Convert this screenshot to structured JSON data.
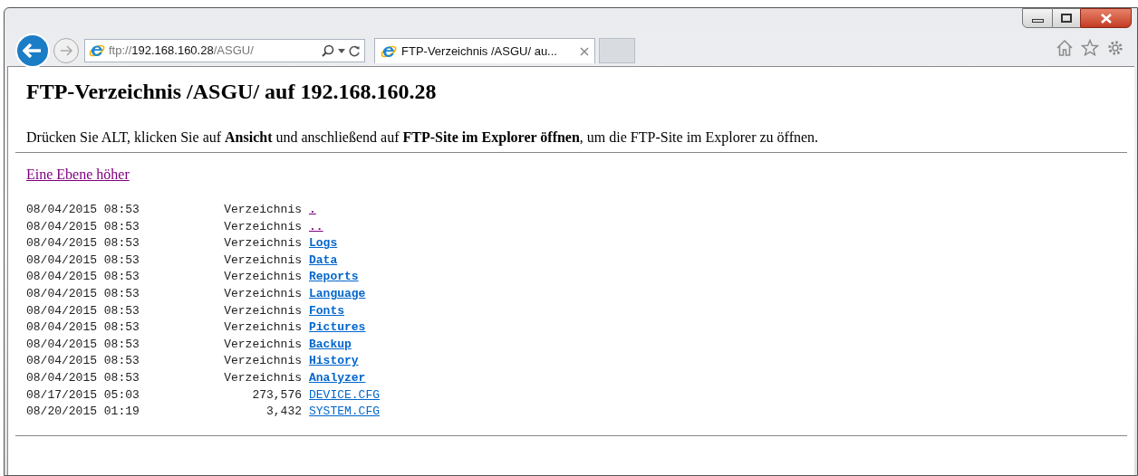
{
  "address": {
    "scheme": "ftp://",
    "host": "192.168.160.28",
    "path": "/ASGU/"
  },
  "tab": {
    "title": "FTP-Verzeichnis /ASGU/ au...",
    "selected": true
  },
  "page": {
    "heading": "FTP-Verzeichnis /ASGU/ auf 192.168.160.28",
    "instruction": "Drücken Sie ALT, klicken Sie auf **Ansicht** und anschließend auf **FTP-Site im Explorer öffnen**, um die FTP-Site im Explorer zu öffnen.",
    "up_link": {
      "label": "Eine Ebene höher",
      "visited": true
    },
    "entries": [
      {
        "date": "08/04/2015 08:53",
        "info": "Verzeichnis",
        "name": ".",
        "kind": "dir",
        "visited": true
      },
      {
        "date": "08/04/2015 08:53",
        "info": "Verzeichnis",
        "name": "..",
        "kind": "dir",
        "visited": true
      },
      {
        "date": "08/04/2015 08:53",
        "info": "Verzeichnis",
        "name": "Logs",
        "kind": "dir",
        "visited": false
      },
      {
        "date": "08/04/2015 08:53",
        "info": "Verzeichnis",
        "name": "Data",
        "kind": "dir",
        "visited": false
      },
      {
        "date": "08/04/2015 08:53",
        "info": "Verzeichnis",
        "name": "Reports",
        "kind": "dir",
        "visited": false
      },
      {
        "date": "08/04/2015 08:53",
        "info": "Verzeichnis",
        "name": "Language",
        "kind": "dir",
        "visited": false
      },
      {
        "date": "08/04/2015 08:53",
        "info": "Verzeichnis",
        "name": "Fonts",
        "kind": "dir",
        "visited": false
      },
      {
        "date": "08/04/2015 08:53",
        "info": "Verzeichnis",
        "name": "Pictures",
        "kind": "dir",
        "visited": false
      },
      {
        "date": "08/04/2015 08:53",
        "info": "Verzeichnis",
        "name": "Backup",
        "kind": "dir",
        "visited": false
      },
      {
        "date": "08/04/2015 08:53",
        "info": "Verzeichnis",
        "name": "History",
        "kind": "dir",
        "visited": false
      },
      {
        "date": "08/04/2015 08:53",
        "info": "Verzeichnis",
        "name": "Analyzer",
        "kind": "dir",
        "visited": false
      },
      {
        "date": "08/17/2015 05:03",
        "info": "273,576",
        "name": "DEVICE.CFG",
        "kind": "file",
        "visited": false
      },
      {
        "date": "08/20/2015 01:19",
        "info": "3,432",
        "name": "SYSTEM.CFG",
        "kind": "file",
        "visited": false
      }
    ]
  }
}
